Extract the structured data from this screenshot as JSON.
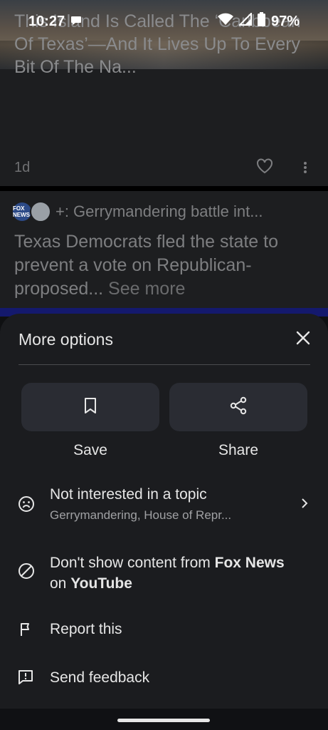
{
  "status_bar": {
    "time": "10:27",
    "battery": "97%"
  },
  "feed": {
    "card1": {
      "title": "This Island Is Called The ‘Caribbean Of Texas’—And It Lives Up To Every Bit Of The Na...",
      "age": "1d"
    },
    "card2": {
      "source_extra": "+:",
      "topic": "Gerrymandering battle int...",
      "headline": "Texas Democrats fled the state to prevent a vote on Republican-proposed...",
      "see_more": "See more",
      "logo_text": "FOX NEWS"
    }
  },
  "sheet": {
    "title": "More options",
    "save_label": "Save",
    "share_label": "Share",
    "not_interested": {
      "title": "Not interested in a topic",
      "subtitle": "Gerrymandering, House of Repr..."
    },
    "dont_show": {
      "prefix": "Don't show content from ",
      "source": "Fox News",
      "line2_prefix": "on ",
      "platform": "YouTube"
    },
    "report_label": "Report this",
    "feedback_label": "Send feedback"
  },
  "icons": [
    "message-icon",
    "wifi-icon",
    "signal-icon",
    "battery-icon",
    "heart-icon",
    "kebab-icon",
    "close-icon",
    "bookmark-icon",
    "share-icon",
    "sad-face-icon",
    "chevron-right-icon",
    "block-icon",
    "flag-icon",
    "feedback-icon"
  ],
  "colors": {
    "sheet_bg": "#1b1c1f",
    "button_bg": "#2a2c33",
    "accent_strip": "#14196d"
  }
}
